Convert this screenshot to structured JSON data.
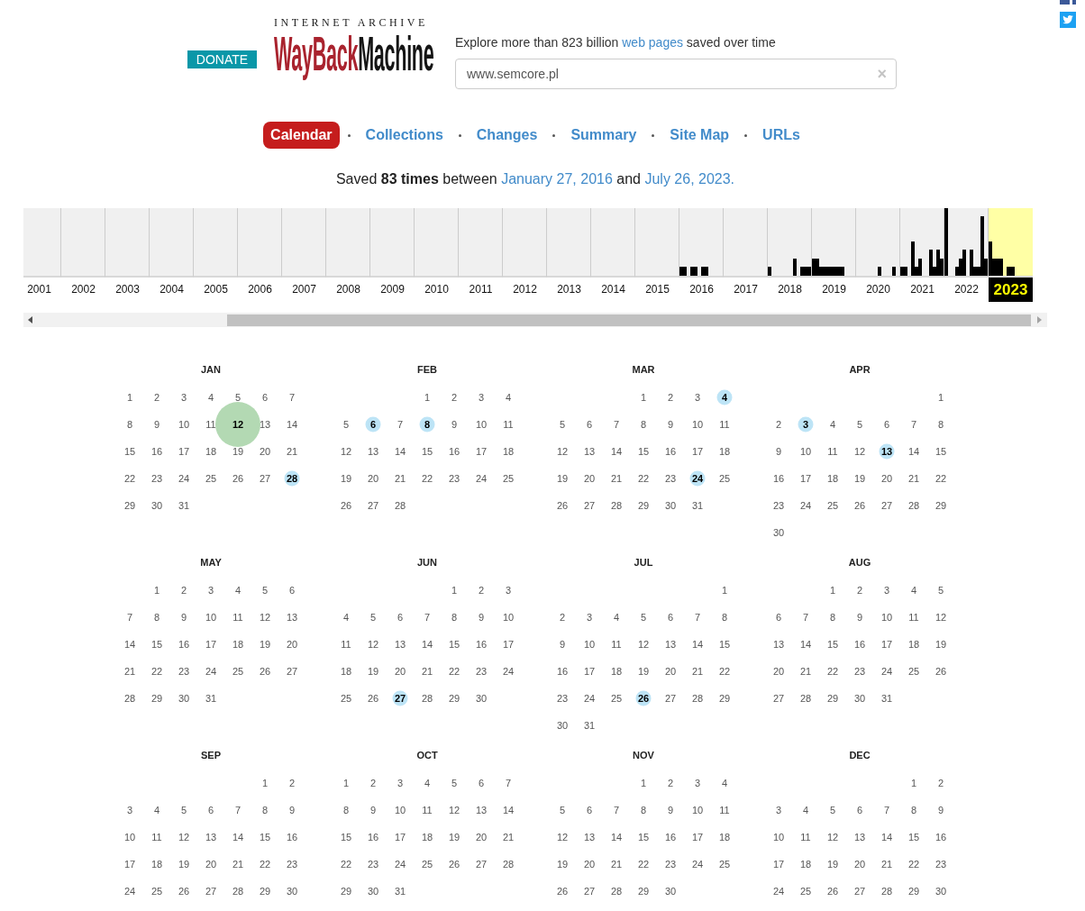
{
  "header": {
    "donate": "DONATE",
    "logo": {
      "top": "INTERNET ARCHIVE",
      "first": "WayBack",
      "second": "Machine"
    },
    "tagline": {
      "before": "Explore more than 823 billion",
      "link": "web pages",
      "after": "saved over time"
    },
    "search": {
      "value": "www.semcore.pl",
      "clear": "×"
    }
  },
  "nav": [
    {
      "label": "Calendar",
      "selected": true
    },
    {
      "label": "Collections",
      "selected": false
    },
    {
      "label": "Changes",
      "selected": false
    },
    {
      "label": "Summary",
      "selected": false
    },
    {
      "label": "Site Map",
      "selected": false
    },
    {
      "label": "URLs",
      "selected": false
    }
  ],
  "summary": {
    "before": "Saved **83 times** between",
    "first_date": "January 27, 2016",
    "middle": "and",
    "last_date": "July 26, 2023."
  },
  "timeline": {
    "years": [
      {
        "label": "2001",
        "selected": false
      },
      {
        "label": "2002",
        "selected": false
      },
      {
        "label": "2003",
        "selected": false
      },
      {
        "label": "2004",
        "selected": false
      },
      {
        "label": "2005",
        "selected": false
      },
      {
        "label": "2006",
        "selected": false
      },
      {
        "label": "2007",
        "selected": false
      },
      {
        "label": "2008",
        "selected": false
      },
      {
        "label": "2009",
        "selected": false
      },
      {
        "label": "2010",
        "selected": false
      },
      {
        "label": "2011",
        "selected": false
      },
      {
        "label": "2012",
        "selected": false
      },
      {
        "label": "2013",
        "selected": false
      },
      {
        "label": "2014",
        "selected": false
      },
      {
        "label": "2015",
        "selected": false
      },
      {
        "label": "2016",
        "selected": false
      },
      {
        "label": "2017",
        "selected": false
      },
      {
        "label": "2018",
        "selected": false
      },
      {
        "label": "2019",
        "selected": false
      },
      {
        "label": "2020",
        "selected": false
      },
      {
        "label": "2021",
        "selected": false
      },
      {
        "label": "2022",
        "selected": false
      },
      {
        "label": "2023",
        "selected": true
      }
    ]
  },
  "calendar": {
    "months": [
      {
        "name": "JAN",
        "weeks": [
          [
            "1",
            "2",
            "3",
            "4",
            "5",
            "6",
            "7"
          ],
          [
            "8",
            "9",
            "10",
            "11",
            {
              "day": "12",
              "color": "#b3d9b3",
              "kind": "large"
            },
            "13",
            "14"
          ],
          [
            "15",
            "16",
            "17",
            "18",
            "19",
            "20",
            "21"
          ],
          [
            "22",
            "23",
            "24",
            "25",
            "26",
            "27",
            {
              "day": "28",
              "color": "#bde4f6",
              "kind": "small"
            }
          ],
          [
            "29",
            "30",
            "31"
          ]
        ]
      },
      {
        "name": "FEB",
        "weeks": [
          [
            "1",
            "2",
            "3",
            "4"
          ],
          [
            "5",
            {
              "day": "6",
              "color": "#bde4f6",
              "kind": "small"
            },
            "7",
            {
              "day": "8",
              "color": "#bde4f6",
              "kind": "small"
            },
            "9",
            "10",
            "11"
          ],
          [
            "12",
            "13",
            "14",
            "15",
            "16",
            "17",
            "18"
          ],
          [
            "19",
            "20",
            "21",
            "22",
            "23",
            "24",
            "25"
          ],
          [
            "26",
            "27",
            "28"
          ]
        ]
      },
      {
        "name": "MAR",
        "weeks": [
          [
            "1",
            "2",
            "3",
            {
              "day": "4",
              "color": "#bde4f6",
              "kind": "small"
            }
          ],
          [
            "5",
            "6",
            "7",
            "8",
            "9",
            "10",
            "11"
          ],
          [
            "12",
            "13",
            "14",
            "15",
            "16",
            "17",
            "18"
          ],
          [
            "19",
            "20",
            "21",
            "22",
            "23",
            {
              "day": "24",
              "color": "#bde4f6",
              "kind": "small"
            },
            "25"
          ],
          [
            "26",
            "27",
            "28",
            "29",
            "30",
            "31"
          ]
        ]
      },
      {
        "name": "APR",
        "weeks": [
          [
            "1"
          ],
          [
            "2",
            {
              "day": "3",
              "color": "#bde4f6",
              "kind": "small"
            },
            "4",
            "5",
            "6",
            "7",
            "8"
          ],
          [
            "9",
            "10",
            "11",
            "12",
            {
              "day": "13",
              "color": "#bde4f6",
              "kind": "small"
            },
            "14",
            "15"
          ],
          [
            "16",
            "17",
            "18",
            "19",
            "20",
            "21",
            "22"
          ],
          [
            "23",
            "24",
            "25",
            "26",
            "27",
            "28",
            "29"
          ],
          [
            "30"
          ]
        ]
      },
      {
        "name": "MAY",
        "weeks": [
          [
            "1",
            "2",
            "3",
            "4",
            "5",
            "6"
          ],
          [
            "7",
            "8",
            "9",
            "10",
            "11",
            "12",
            "13"
          ],
          [
            "14",
            "15",
            "16",
            "17",
            "18",
            "19",
            "20"
          ],
          [
            "21",
            "22",
            "23",
            "24",
            "25",
            "26",
            "27"
          ],
          [
            "28",
            "29",
            "30",
            "31"
          ]
        ]
      },
      {
        "name": "JUN",
        "weeks": [
          [
            "1",
            "2",
            "3"
          ],
          [
            "4",
            "5",
            "6",
            "7",
            "8",
            "9",
            "10"
          ],
          [
            "11",
            "12",
            "13",
            "14",
            "15",
            "16",
            "17"
          ],
          [
            "18",
            "19",
            "20",
            "21",
            "22",
            "23",
            "24"
          ],
          [
            "25",
            "26",
            {
              "day": "27",
              "color": "#bde4f6",
              "kind": "small"
            },
            "28",
            "29",
            "30"
          ]
        ]
      },
      {
        "name": "JUL",
        "weeks": [
          [
            "1"
          ],
          [
            "2",
            "3",
            "4",
            "5",
            "6",
            "7",
            "8"
          ],
          [
            "9",
            "10",
            "11",
            "12",
            "13",
            "14",
            "15"
          ],
          [
            "16",
            "17",
            "18",
            "19",
            "20",
            "21",
            "22"
          ],
          [
            "23",
            "24",
            "25",
            {
              "day": "26",
              "color": "#bde4f6",
              "kind": "small"
            },
            "27",
            "28",
            "29"
          ],
          [
            "30",
            "31"
          ]
        ]
      },
      {
        "name": "AUG",
        "weeks": [
          [
            "1",
            "2",
            "3",
            "4",
            "5"
          ],
          [
            "6",
            "7",
            "8",
            "9",
            "10",
            "11",
            "12"
          ],
          [
            "13",
            "14",
            "15",
            "16",
            "17",
            "18",
            "19"
          ],
          [
            "20",
            "21",
            "22",
            "23",
            "24",
            "25",
            "26"
          ],
          [
            "27",
            "28",
            "29",
            "30",
            "31"
          ]
        ]
      },
      {
        "name": "SEP",
        "weeks": [
          [
            "1",
            "2"
          ],
          [
            "3",
            "4",
            "5",
            "6",
            "7",
            "8",
            "9"
          ],
          [
            "10",
            "11",
            "12",
            "13",
            "14",
            "15",
            "16"
          ],
          [
            "17",
            "18",
            "19",
            "20",
            "21",
            "22",
            "23"
          ],
          [
            "24",
            "25",
            "26",
            "27",
            "28",
            "29",
            "30"
          ]
        ]
      },
      {
        "name": "OCT",
        "weeks": [
          [
            "1",
            "2",
            "3",
            "4",
            "5",
            "6",
            "7"
          ],
          [
            "8",
            "9",
            "10",
            "11",
            "12",
            "13",
            "14"
          ],
          [
            "15",
            "16",
            "17",
            "18",
            "19",
            "20",
            "21"
          ],
          [
            "22",
            "23",
            "24",
            "25",
            "26",
            "27",
            "28"
          ],
          [
            "29",
            "30",
            "31"
          ]
        ]
      },
      {
        "name": "NOV",
        "weeks": [
          [
            "1",
            "2",
            "3",
            "4"
          ],
          [
            "5",
            "6",
            "7",
            "8",
            "9",
            "10",
            "11"
          ],
          [
            "12",
            "13",
            "14",
            "15",
            "16",
            "17",
            "18"
          ],
          [
            "19",
            "20",
            "21",
            "22",
            "23",
            "24",
            "25"
          ],
          [
            "26",
            "27",
            "28",
            "29",
            "30"
          ]
        ]
      },
      {
        "name": "DEC",
        "weeks": [
          [
            "1",
            "2"
          ],
          [
            "3",
            "4",
            "5",
            "6",
            "7",
            "8",
            "9"
          ],
          [
            "10",
            "11",
            "12",
            "13",
            "14",
            "15",
            "16"
          ],
          [
            "17",
            "18",
            "19",
            "20",
            "21",
            "22",
            "23"
          ],
          [
            "24",
            "25",
            "26",
            "27",
            "28",
            "29",
            "30"
          ]
        ]
      }
    ]
  }
}
